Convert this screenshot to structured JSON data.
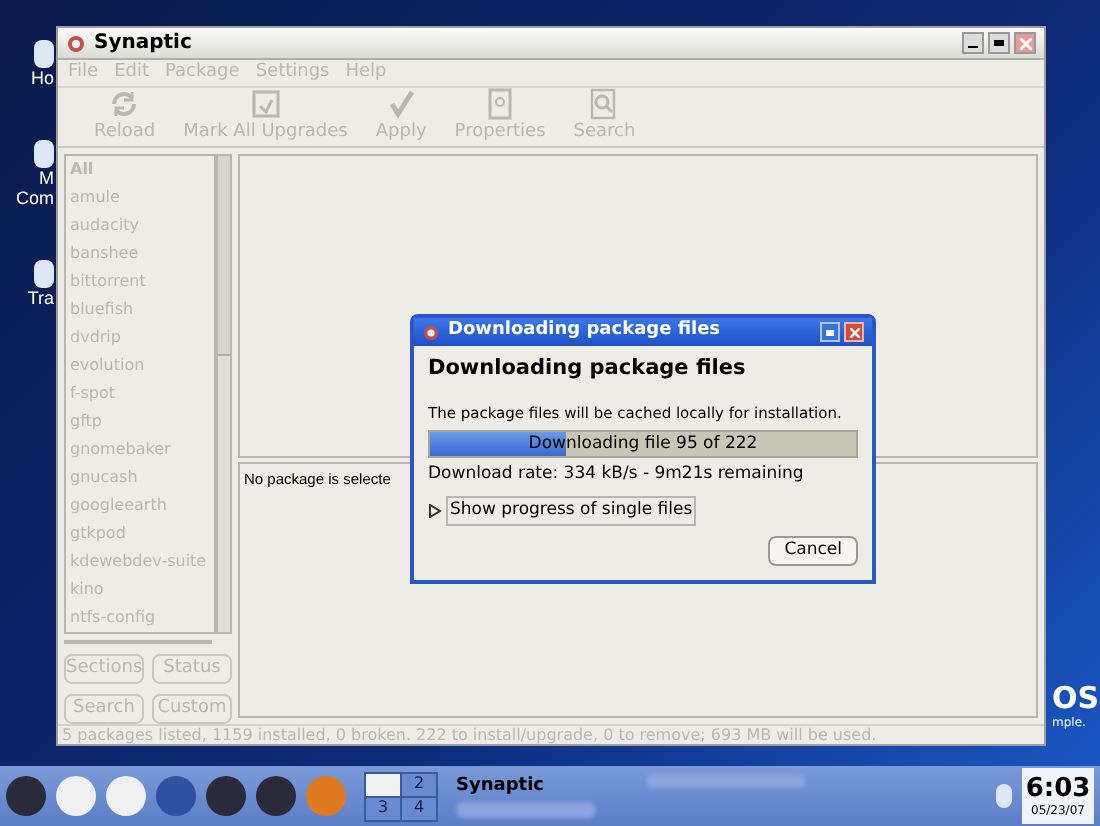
{
  "desktop_icons": [
    {
      "lines": [
        "Ho"
      ]
    },
    {
      "lines": [
        "M",
        "Com"
      ]
    },
    {
      "lines": [
        "Tra"
      ]
    }
  ],
  "desktop_logo": {
    "text": "OS",
    "tagline": "mple."
  },
  "window": {
    "title": "Synaptic",
    "menu": [
      {
        "label": "File",
        "disabled": true
      },
      {
        "label": "Edit",
        "disabled": true
      },
      {
        "label": "Package",
        "disabled": true
      },
      {
        "label": "Settings",
        "disabled": true
      },
      {
        "label": "Help",
        "disabled": true
      }
    ],
    "toolbar": [
      {
        "label": "Reload",
        "kind": "reload",
        "disabled": true
      },
      {
        "label": "Mark All Upgrades",
        "kind": "upgrade",
        "disabled": true
      },
      {
        "label": "Apply",
        "kind": "apply",
        "disabled": true
      },
      {
        "label": "Properties",
        "kind": "properties",
        "disabled": true
      },
      {
        "label": "Search",
        "kind": "search",
        "disabled": true
      }
    ],
    "filter_list": [
      {
        "label": "All",
        "disabled": true
      },
      {
        "label": "amule",
        "disabled": true
      },
      {
        "label": "audacity",
        "disabled": true
      },
      {
        "label": "banshee",
        "disabled": true
      },
      {
        "label": "bittorrent",
        "disabled": true
      },
      {
        "label": "bluefish",
        "disabled": true
      },
      {
        "label": "dvdrip",
        "disabled": true
      },
      {
        "label": "evolution",
        "disabled": true
      },
      {
        "label": "f-spot",
        "disabled": true
      },
      {
        "label": "gftp",
        "disabled": true
      },
      {
        "label": "gnomebaker",
        "disabled": true
      },
      {
        "label": "gnucash",
        "disabled": true
      },
      {
        "label": "googleearth",
        "disabled": true
      },
      {
        "label": "gtkpod",
        "disabled": true
      },
      {
        "label": "kdewebdev-suite",
        "disabled": true
      },
      {
        "label": "kino",
        "disabled": true
      },
      {
        "label": "ntfs-config",
        "disabled": true
      }
    ],
    "filter_buttons": [
      {
        "label": "Sections",
        "disabled": true
      },
      {
        "label": "Status",
        "disabled": true
      },
      {
        "label": "Search",
        "disabled": true
      },
      {
        "label": "Custom",
        "disabled": true
      }
    ],
    "details_text": "No package is selecte",
    "status_bar": "5 packages listed, 1159 installed, 0 broken. 222 to install/upgrade, 0 to remove; 693 MB will be used."
  },
  "dialog": {
    "title": "Downloading package files",
    "heading": "Downloading package files",
    "message": "The package files will be cached locally for installation.",
    "progress": {
      "level": 0.32,
      "label": "Downloading file 95 of 222"
    },
    "rate": "Download rate: 334 kB/s - 9m21s remaining",
    "expander": {
      "label": "Show progress of single files",
      "expanded": false
    },
    "button": "Cancel"
  },
  "taskbar": {
    "pager": [
      {
        "selected": true
      },
      {
        "label": "2",
        "selected": false
      },
      {
        "label": "3",
        "selected": false
      },
      {
        "label": "4",
        "selected": false
      }
    ],
    "task": "Synaptic",
    "clock": "6:03",
    "date": "05/23/07"
  }
}
